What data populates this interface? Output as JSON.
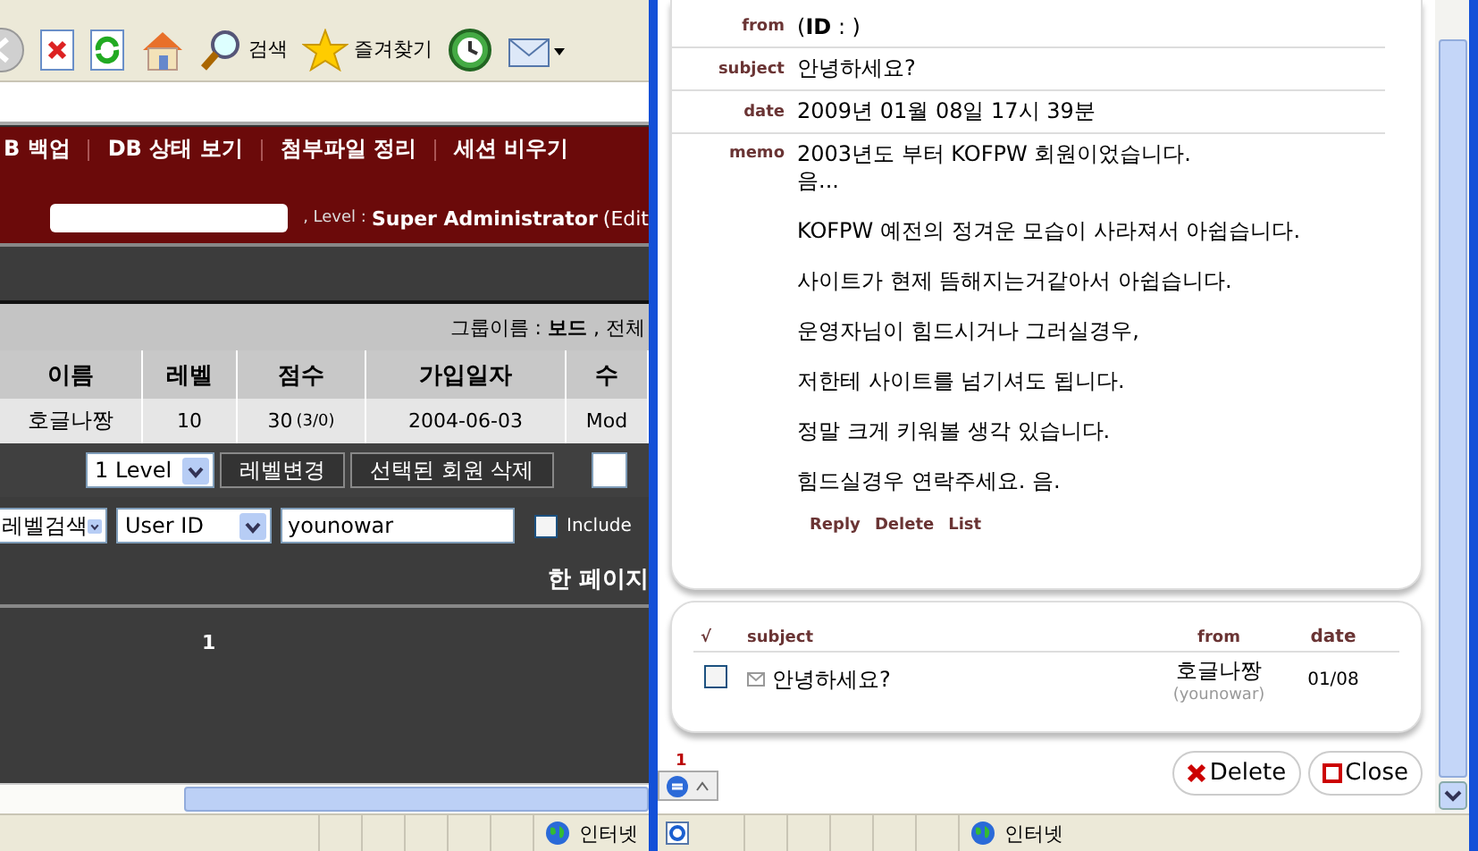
{
  "browser": {
    "toolbar": [
      {
        "kind": "back"
      },
      {
        "kind": "stop"
      },
      {
        "kind": "refresh"
      },
      {
        "kind": "home"
      },
      {
        "kind": "search",
        "label": "검색"
      },
      {
        "kind": "favorites",
        "label": "즐겨찾기"
      },
      {
        "kind": "history"
      },
      {
        "kind": "mail"
      }
    ],
    "nav": [
      "B 백업",
      "DB 상태 보기",
      "첨부파일 정리",
      "세션 비우기"
    ],
    "user_line": {
      "prefix": ", Level :",
      "role": "Super Administrator",
      "edit": "(Edit"
    },
    "group_bar": "그룹이름 : **보드** , 전체",
    "member_table": {
      "columns": [
        "이름",
        "레벨",
        "점수",
        "가입일자",
        "수"
      ],
      "rows": [
        {
          "cells": [
            "호글나짱",
            "10",
            "30",
            "2004-06-03",
            "Mod"
          ],
          "score_detail": "(3/0)"
        }
      ]
    },
    "level_controls": {
      "level_select": "1 Level",
      "buttons": [
        "레벨변경",
        "선택된 회원 삭제"
      ]
    },
    "search": {
      "scope_select": "레벨검색",
      "field_select": "User ID",
      "query": "younowar",
      "include": {
        "label": "Include",
        "checked": false
      }
    },
    "per_page_label": "한 페이지",
    "pagination": [
      "1"
    ],
    "status_bar": {
      "zone": "인터넷"
    }
  },
  "popup": {
    "fields": [
      {
        "label": "from",
        "value": "(**ID** : )"
      },
      {
        "label": "subject",
        "value": "안녕하세요?"
      },
      {
        "label": "date",
        "value": "2009년 01월 08일 17시 39분"
      }
    ],
    "memo": {
      "label": "memo",
      "paragraphs": [
        [
          "2003년도 부터 KOFPW 회원이었습니다.",
          "음..."
        ],
        [
          "KOFPW 예전의 정겨운 모습이 사라져서 아쉽습니다."
        ],
        [
          "사이트가 현제 뜸해지는거같아서 아쉽습니다."
        ],
        [
          "운영자님이 힘드시거나 그러실경우,"
        ],
        [
          "저한테 사이트를 넘기셔도 됩니다."
        ],
        [
          "정말 크게 키워볼 생각 있습니다."
        ],
        [
          "힘드실경우 연락주세요. 음."
        ]
      ]
    },
    "actions": [
      "Reply",
      "Delete",
      "List"
    ],
    "list": {
      "columns": [
        "√",
        "subject",
        "from",
        "date"
      ],
      "rows": [
        {
          "checked": false,
          "subject": "안녕하세요?",
          "from": "호글나짱",
          "from_id": "(younowar)",
          "date": "01/08"
        }
      ]
    },
    "buttons": [
      {
        "kind": "delete",
        "label": "Delete"
      },
      {
        "kind": "close",
        "label": "Close"
      }
    ],
    "widget_count": "1",
    "status_bar": {
      "zone": "인터넷"
    }
  }
}
